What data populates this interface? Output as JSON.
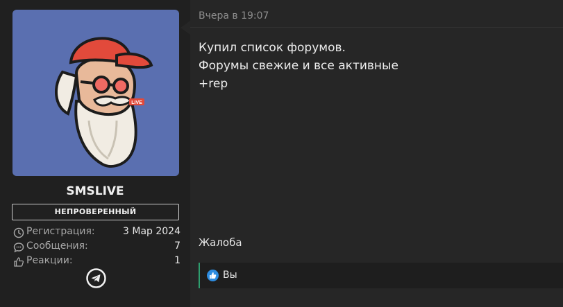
{
  "user": {
    "name": "SMSLIVE",
    "badge": "НЕПРОВЕРЕННЫЙ",
    "avatar_live_text": "LIVE",
    "stats": [
      {
        "label": "Регистрация:",
        "value": "3 Мар 2024",
        "icon": "clock-icon"
      },
      {
        "label": "Сообщения:",
        "value": "7",
        "icon": "speech-bubble-icon"
      },
      {
        "label": "Реакции:",
        "value": "1",
        "icon": "thumbs-up-icon"
      }
    ],
    "social_icon": "telegram-icon"
  },
  "post": {
    "date": "Вчера в 19:07",
    "lines": [
      "Купил список форумов.",
      "Форумы свежие и все активные",
      "+rep"
    ],
    "report_label": "Жалоба",
    "reactions_label": "Вы"
  },
  "colors": {
    "avatar_bg": "#5a6fb0",
    "reaction_accent": "#2e9e6e",
    "like_icon": "#2d8ce0"
  }
}
